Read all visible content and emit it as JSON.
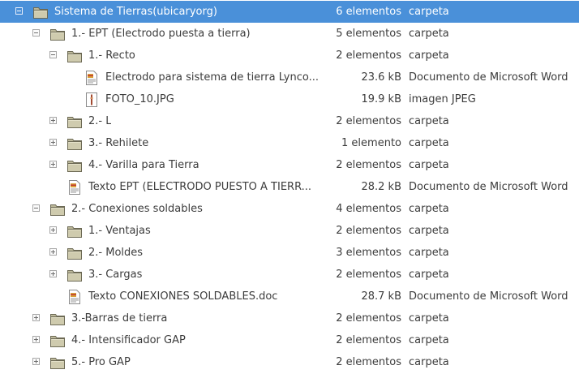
{
  "rows": [
    {
      "id": "r0",
      "name": "Sistema de Tierras(ubicaryorg)",
      "size": "6 elementos",
      "type": "carpeta",
      "icon": "folder-icon",
      "expander": "expanded",
      "selected": true
    },
    {
      "id": "r1",
      "name": "1.- EPT (Electrodo puesta a tierra)",
      "size": "5 elementos",
      "type": "carpeta",
      "icon": "folder-icon",
      "expander": "expanded"
    },
    {
      "id": "r2",
      "name": "1.- Recto",
      "size": "2 elementos",
      "type": "carpeta",
      "icon": "folder-icon",
      "expander": "expanded"
    },
    {
      "id": "r3",
      "name": "Electrodo para sistema de tierra Lynco...",
      "size": "23.6 kB",
      "type": "Documento de Microsoft Word",
      "icon": "word-document-icon"
    },
    {
      "id": "r4",
      "name": "FOTO_10.JPG",
      "size": "19.9 kB",
      "type": "imagen JPEG",
      "icon": "jpeg-image-icon"
    },
    {
      "id": "r5",
      "name": "2.- L",
      "size": "2 elementos",
      "type": "carpeta",
      "icon": "folder-icon",
      "expander": "collapsed"
    },
    {
      "id": "r6",
      "name": "3.- Rehilete",
      "size": "1 elemento",
      "type": "carpeta",
      "icon": "folder-icon",
      "expander": "collapsed"
    },
    {
      "id": "r7",
      "name": "4.- Varilla para Tierra",
      "size": "2 elementos",
      "type": "carpeta",
      "icon": "folder-icon",
      "expander": "collapsed"
    },
    {
      "id": "r8",
      "name": "Texto EPT (ELECTRODO PUESTO A TIERR...",
      "size": "28.2 kB",
      "type": "Documento de Microsoft Word",
      "icon": "word-document-icon"
    },
    {
      "id": "r9",
      "name": "2.- Conexiones soldables",
      "size": "4 elementos",
      "type": "carpeta",
      "icon": "folder-icon",
      "expander": "expanded"
    },
    {
      "id": "r10",
      "name": "1.- Ventajas",
      "size": "2 elementos",
      "type": "carpeta",
      "icon": "folder-icon",
      "expander": "collapsed"
    },
    {
      "id": "r11",
      "name": "2.- Moldes",
      "size": "3 elementos",
      "type": "carpeta",
      "icon": "folder-icon",
      "expander": "collapsed"
    },
    {
      "id": "r12",
      "name": "3.- Cargas",
      "size": "2 elementos",
      "type": "carpeta",
      "icon": "folder-icon",
      "expander": "collapsed"
    },
    {
      "id": "r13",
      "name": "Texto CONEXIONES SOLDABLES.doc",
      "size": "28.7 kB",
      "type": "Documento de Microsoft Word",
      "icon": "word-document-icon"
    },
    {
      "id": "r14",
      "name": "3.-Barras de tierra",
      "size": "2 elementos",
      "type": "carpeta",
      "icon": "folder-icon",
      "expander": "collapsed"
    },
    {
      "id": "r15",
      "name": "4.- Intensificador GAP",
      "size": "2 elementos",
      "type": "carpeta",
      "icon": "folder-icon",
      "expander": "collapsed"
    },
    {
      "id": "r16",
      "name": "5.- Pro GAP",
      "size": "2 elementos",
      "type": "carpeta",
      "icon": "folder-icon",
      "expander": "collapsed"
    }
  ],
  "colors": {
    "selection": "#4a90d9",
    "folder": "#b9b597",
    "text": "#3c3c3c"
  }
}
